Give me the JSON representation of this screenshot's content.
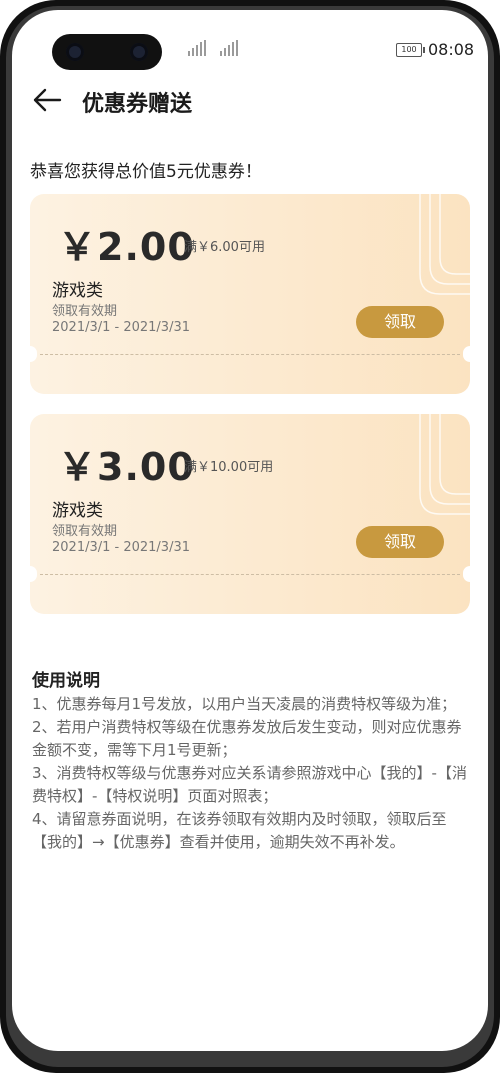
{
  "status": {
    "time": "08:08",
    "battery": "100"
  },
  "header": {
    "title": "优惠券赠送"
  },
  "congrats": "恭喜您获得总价值5元优惠券！",
  "coupons": [
    {
      "amount": "￥2.00",
      "condition": "满￥6.00可用",
      "category": "游戏类",
      "valid_label": "领取有效期",
      "valid_range": "2021/3/1 - 2021/3/31",
      "claim": "领取"
    },
    {
      "amount": "￥3.00",
      "condition": "满￥10.00可用",
      "category": "游戏类",
      "valid_label": "领取有效期",
      "valid_range": "2021/3/1 - 2021/3/31",
      "claim": "领取"
    }
  ],
  "usage": {
    "title": "使用说明",
    "text": "1、优惠券每月1号发放，以用户当天凌晨的消费特权等级为准；\n2、若用户消费特权等级在优惠券发放后发生变动，则对应优惠券金额不变，需等下月1号更新；\n3、消费特权等级与优惠券对应关系请参照游戏中心【我的】-【消费特权】-【特权说明】页面对照表；\n4、请留意券面说明，在该券领取有效期内及时领取，领取后至【我的】→【优惠券】查看并使用，逾期失效不再补发。"
  },
  "colors": {
    "claim_button": "#c8993f",
    "card_start": "#fdf2e2",
    "card_end": "#fbe3c1"
  }
}
